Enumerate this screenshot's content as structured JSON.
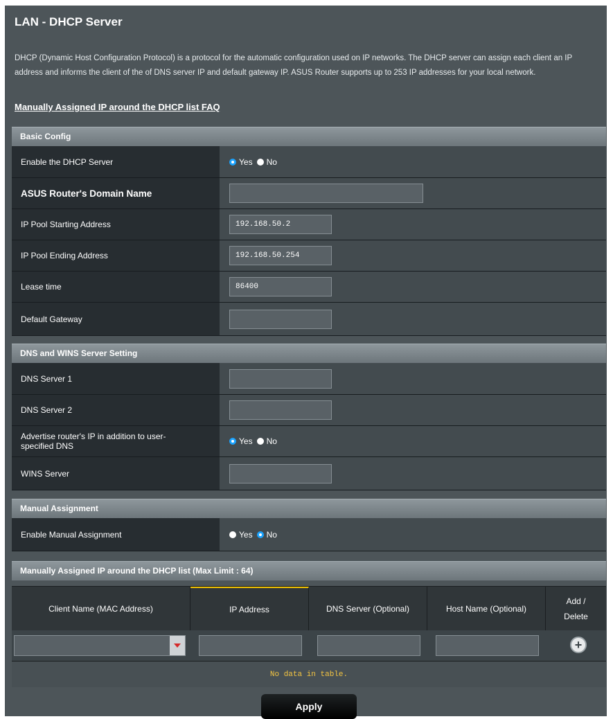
{
  "page": {
    "title": "LAN - DHCP Server",
    "description": "DHCP (Dynamic Host Configuration Protocol) is a protocol for the automatic configuration used on IP networks. The DHCP server can assign each client an IP address and informs the client of the of DNS server IP and default gateway IP. ASUS Router supports up to 253 IP addresses for your local network.",
    "faq_link": "Manually Assigned IP around the DHCP list FAQ"
  },
  "basic": {
    "header": "Basic Config",
    "enable_label": "Enable the DHCP Server",
    "enable_yes": "Yes",
    "enable_no": "No",
    "enable_value": "Yes",
    "domain_label": "ASUS Router's Domain Name",
    "domain_value": "",
    "pool_start_label": "IP Pool Starting Address",
    "pool_start_value": "192.168.50.2",
    "pool_end_label": "IP Pool Ending Address",
    "pool_end_value": "192.168.50.254",
    "lease_label": "Lease time",
    "lease_value": "86400",
    "gateway_label": "Default Gateway",
    "gateway_value": ""
  },
  "dns": {
    "header": "DNS and WINS Server Setting",
    "dns1_label": "DNS Server 1",
    "dns1_value": "",
    "dns2_label": "DNS Server 2",
    "dns2_value": "",
    "advertise_label": "Advertise router's IP in addition to user-specified DNS",
    "advertise_yes": "Yes",
    "advertise_no": "No",
    "advertise_value": "Yes",
    "wins_label": "WINS Server",
    "wins_value": ""
  },
  "manual": {
    "header": "Manual Assignment",
    "enable_label": "Enable Manual Assignment",
    "enable_yes": "Yes",
    "enable_no": "No",
    "enable_value": "No"
  },
  "list": {
    "header": "Manually Assigned IP around the DHCP list (Max Limit : 64)",
    "columns": [
      "Client Name (MAC Address)",
      "IP Address",
      "DNS Server (Optional)",
      "Host Name (Optional)",
      "Add / Delete"
    ],
    "empty_text": "No data in table."
  },
  "apply_label": "Apply",
  "colors": {
    "accent": "#1aa3ff",
    "nodata_text": "#f4c542",
    "active_column": "#f0c000"
  }
}
